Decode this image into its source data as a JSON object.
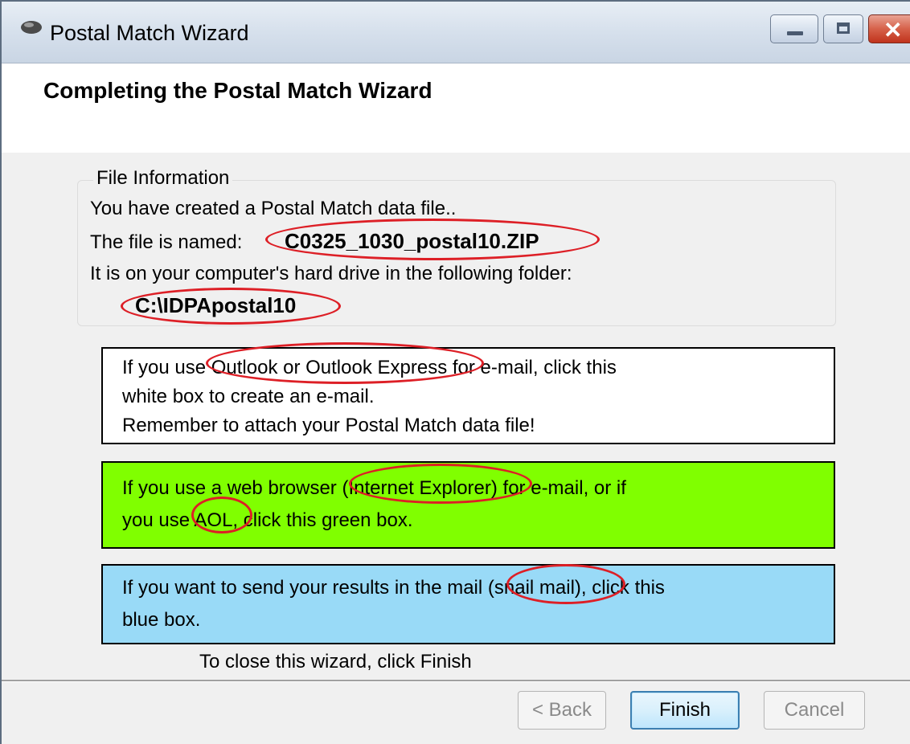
{
  "window": {
    "title": "Postal Match Wizard",
    "close_glyph": "✕"
  },
  "header": {
    "title": "Completing the Postal Match Wizard"
  },
  "file_info": {
    "legend": "File Information",
    "created_text": "You have created a Postal Match data file..",
    "named_label": "The file is named:",
    "file_name": "C0325_1030_postal10.ZIP",
    "folder_text": "It is on your computer's hard drive in the following folder:",
    "folder_path": "C:\\IDPApostal10"
  },
  "options": {
    "white_box": {
      "lines": [
        "If you use Outlook or Outlook Express for e-mail, click this",
        "white box to create an e-mail.",
        "Remember to attach your Postal Match data file!"
      ],
      "color": "#ffffff"
    },
    "green_box": {
      "lines": [
        "If you use a web browser (Internet Explorer) for e-mail, or if",
        "you use AOL, click this green box."
      ],
      "color": "#80ff00"
    },
    "blue_box": {
      "lines": [
        "If you want to send your results in the mail (snail mail), click this",
        "blue box."
      ],
      "color": "#99daf7"
    }
  },
  "close_hint": "To close this wizard, click Finish",
  "buttons": {
    "back": "< Back",
    "finish": "Finish",
    "cancel": "Cancel"
  },
  "colors": {
    "annotation_ring": "#dd1f26",
    "finish_focus": "#3c7fb1"
  },
  "icons": {
    "app": "wizard-app-icon",
    "minimize": "minimize-icon",
    "maximize": "maximize-icon",
    "close": "close-icon"
  }
}
